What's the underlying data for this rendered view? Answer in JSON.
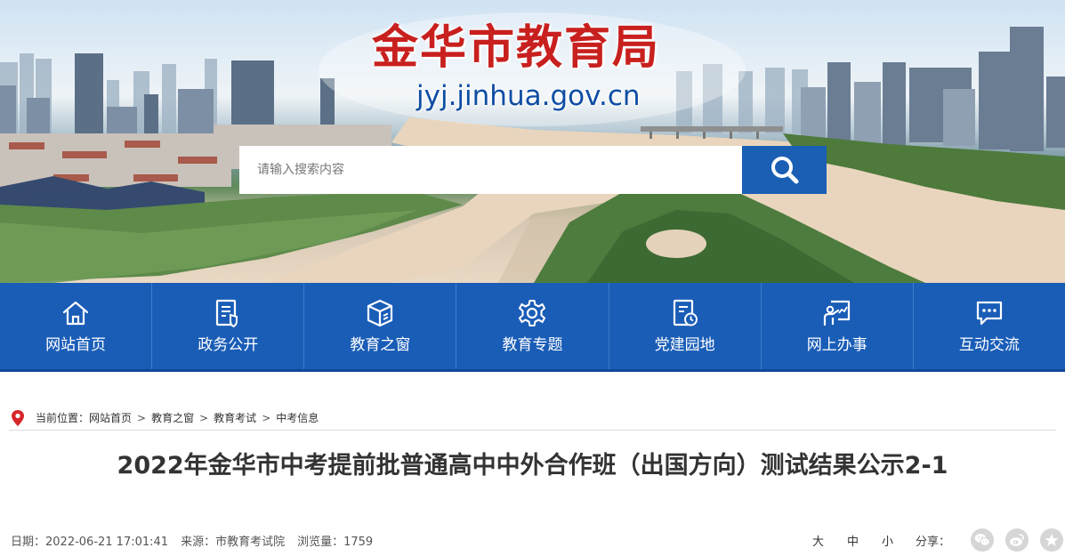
{
  "header": {
    "title": "金华市教育局",
    "domain": "jyj.jinhua.gov.cn"
  },
  "search": {
    "placeholder": "请输入搜索内容"
  },
  "nav": {
    "items": [
      {
        "label": "网站首页",
        "icon": "home-icon"
      },
      {
        "label": "政务公开",
        "icon": "document-shield-icon"
      },
      {
        "label": "教育之窗",
        "icon": "box-icon"
      },
      {
        "label": "教育专题",
        "icon": "gear-icon"
      },
      {
        "label": "党建园地",
        "icon": "document-clock-icon"
      },
      {
        "label": "网上办事",
        "icon": "presentation-icon"
      },
      {
        "label": "互动交流",
        "icon": "chat-icon"
      }
    ]
  },
  "breadcrumb": {
    "prefix": "当前位置：",
    "items": [
      "网站首页",
      "教育之窗",
      "教育考试",
      "中考信息"
    ],
    "separator": ">"
  },
  "article": {
    "title": "2022年金华市中考提前批普通高中中外合作班（出国方向）测试结果公示2-1",
    "date": "日期：2022-06-21 17:01:41",
    "source": "来源：市教育考试院",
    "views": "浏览量：1759"
  },
  "tools": {
    "font_large": "大",
    "font_medium": "中",
    "font_small": "小",
    "share_label": "分享：",
    "share_icons": [
      "wechat-icon",
      "weibo-icon",
      "favorite-icon"
    ]
  },
  "colors": {
    "brand_blue": "#1a5db7",
    "title_red": "#c8201e",
    "domain_blue": "#0e4da4",
    "pin_red": "#d6262b"
  }
}
